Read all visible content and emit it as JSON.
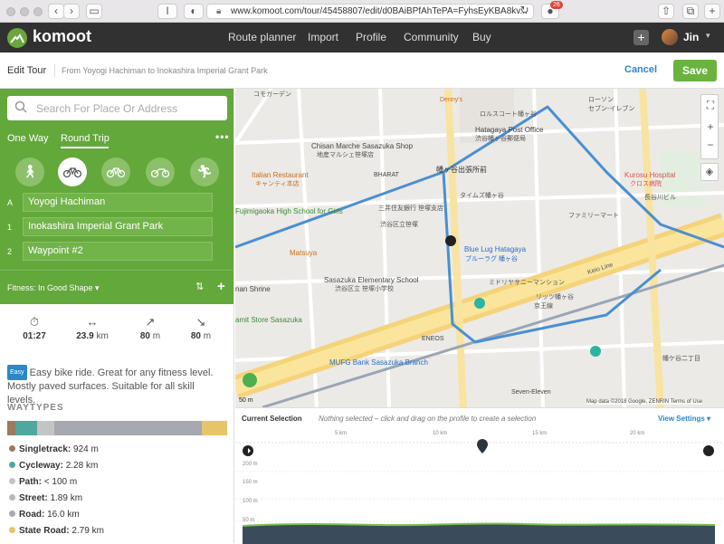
{
  "browser": {
    "url": "www.komoot.com/tour/45458807/edit/d0BAiBPfAhTePA=FyhsEyKBA8kv...",
    "notification_count": "26"
  },
  "nav": {
    "logo_text": "komoot",
    "links": [
      "Route planner",
      "Import",
      "Profile",
      "Community",
      "Buy"
    ],
    "user_name": "Jin"
  },
  "edit": {
    "title": "Edit Tour",
    "subtitle": "From Yoyogi Hachiman to Inokashira Imperial Grant Park",
    "cancel_label": "Cancel",
    "save_label": "Save"
  },
  "planner": {
    "search_placeholder": "Search For Place Or Address",
    "trip_modes": [
      "One Way",
      "Round Trip"
    ],
    "selected_trip_mode": "Round Trip",
    "more_label": "•••",
    "sports": [
      "hiking-icon",
      "bike-icon",
      "mountain-bike-icon",
      "road-bike-icon",
      "running-icon"
    ],
    "selected_sport": "bike-icon",
    "waypoints": [
      {
        "key": "A",
        "label": "Yoyogi Hachiman"
      },
      {
        "key": "1",
        "label": "Inokashira Imperial Grant Park"
      },
      {
        "key": "2",
        "label": "Waypoint #2"
      }
    ],
    "fitness_label": "Fitness: In Good Shape ▾"
  },
  "stats": {
    "duration": "01:27",
    "distance_value": "23.9",
    "distance_unit": "km",
    "uphill_value": "80",
    "uphill_unit": "m",
    "downhill_value": "80",
    "downhill_unit": "m"
  },
  "difficulty": {
    "badge": "Easy",
    "text": "Easy bike ride. Great for any fitness level. Mostly paved surfaces. Suitable for all skill levels."
  },
  "waytypes": {
    "heading": "WAYTYPES",
    "items": [
      {
        "name": "Singletrack:",
        "value": "924 m",
        "color": "#9c7b5e",
        "share": 0.039
      },
      {
        "name": "Cycleway:",
        "value": "2.28 km",
        "color": "#4fa79d",
        "share": 0.095
      },
      {
        "name": "Path:",
        "value": "< 100 m",
        "color": "#c4c4c4",
        "share": 0.08
      },
      {
        "name": "Street:",
        "value": "1.89 km",
        "color": "#b6b9be",
        "share": 0.0
      },
      {
        "name": "Road:",
        "value": "16.0 km",
        "color": "#a6a9b0",
        "share": 0.67
      },
      {
        "name": "State Road:",
        "value": "2.79 km",
        "color": "#e6c46a",
        "share": 0.117
      }
    ]
  },
  "map": {
    "labels": [
      "コモガーデン",
      "Denny's",
      "ロルスコート幡ヶ谷",
      "ローソン",
      "セブン-イレブン",
      "Chisan Marche Sasazuka Shop",
      "地産マルシェ笹塚店",
      "Hatagaya Post Office",
      "渋谷幡ヶ谷郵便局",
      "Italian Restaurant",
      "キャンティ本店",
      "BHARAT",
      "幡ヶ谷出張所前",
      "Kurosu Hospital",
      "クロス病院",
      "タイムズ幡ヶ谷",
      "長谷川ビル",
      "Fujimigaoka High School for Girls",
      "三井住友銀行 笹塚支店",
      "渋谷区立笹塚",
      "ファミリーマート",
      "Blue Lug Hatagaya",
      "ブルーラグ 幡ヶ谷",
      "Matsuya",
      "Sasazuka Elementary School",
      "渋谷区立 笹塚小学校",
      "ミドリヤサニーマンション",
      "リッツ幡ヶ谷",
      "nan Shrine",
      "amit Store Sasazuka",
      "ENEOS",
      "MUFG Bank Sasazuka Branch",
      "Keio Line",
      "京王線",
      "Seven-Eleven",
      "幡ケ谷二丁目",
      "Map data ©2018 Google, ZENRIN  Terms of Use",
      "50 m"
    ]
  },
  "profile": {
    "current_selection_label": "Current Selection",
    "hint": "Nothing selected – click and drag on the profile to create a selection",
    "view_settings": "View Settings ▾",
    "km_ticks": [
      "5 km",
      "10 km",
      "15 km",
      "20 km"
    ],
    "alt_ticks": [
      "200 m",
      "150 m",
      "100 m",
      "50 m"
    ]
  }
}
